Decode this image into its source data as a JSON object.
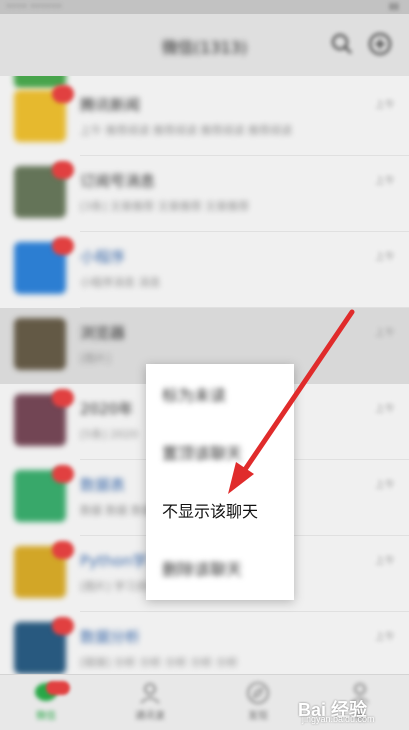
{
  "status_bar": {
    "left": "•••• ••••••",
    "right": "▮▮"
  },
  "header": {
    "title": "微信(1313)"
  },
  "chats": [
    {
      "name": "",
      "preview": "",
      "time": "",
      "badge": "",
      "avatar_color": "#4caf50",
      "name_style": "normal"
    },
    {
      "name": "腾讯新闻",
      "preview": "上午 推荐阅读 推荐阅读 推荐阅读 推荐阅读",
      "time": "上午",
      "badge": "",
      "avatar_color": "#f5c531",
      "name_style": "normal"
    },
    {
      "name": "订阅号消息",
      "preview": "[3条] 文章推荐 文章推荐 文章推荐",
      "time": "上午",
      "badge": "",
      "avatar_color": "#6b7c5e",
      "name_style": "normal"
    },
    {
      "name": "小程序",
      "preview": "小程序消息 消息",
      "time": "上午",
      "badge": "",
      "avatar_color": "#2f86e0",
      "name_style": "blue"
    },
    {
      "name": "浏览器",
      "preview": "[图片]",
      "time": "上午",
      "badge": "",
      "avatar_color": "#6a5f4a",
      "name_style": "normal"
    },
    {
      "name": "2020年",
      "preview": "[5条] 2020",
      "time": "上午",
      "badge": "",
      "avatar_color": "#7a4a5a",
      "name_style": "normal"
    },
    {
      "name": "数据表",
      "preview": "数据 数据 数据",
      "time": "上午",
      "badge": "",
      "avatar_color": "#3cb371",
      "name_style": "blue"
    },
    {
      "name": "Python学习",
      "preview": "[图片] 学习资料",
      "time": "上午",
      "badge": "",
      "avatar_color": "#e0b12a",
      "name_style": "blue"
    },
    {
      "name": "数据分析",
      "preview": "[链接] 分析 分析 分析 分析 分析",
      "time": "上午",
      "badge": "",
      "avatar_color": "#2b5f87",
      "name_style": "normal"
    }
  ],
  "context_menu": {
    "items": [
      {
        "label": "标为未读",
        "blurred": true
      },
      {
        "label": "置顶该聊天",
        "blurred": true
      },
      {
        "label": "不显示该聊天",
        "blurred": false
      },
      {
        "label": "删除该聊天",
        "blurred": true
      }
    ]
  },
  "tab_bar": {
    "tabs": [
      {
        "label": "微信",
        "icon": "chat-icon",
        "active": true
      },
      {
        "label": "通讯录",
        "icon": "contacts-icon",
        "active": false
      },
      {
        "label": "发现",
        "icon": "discover-icon",
        "active": false
      },
      {
        "label": "我",
        "icon": "me-icon",
        "active": false
      }
    ]
  },
  "watermark": {
    "brand": "Bai 经验",
    "sub": "jingyan.baidu.com"
  },
  "colors": {
    "accent": "#2bb24c",
    "badge": "#f04545",
    "arrow": "#e02b2b"
  }
}
